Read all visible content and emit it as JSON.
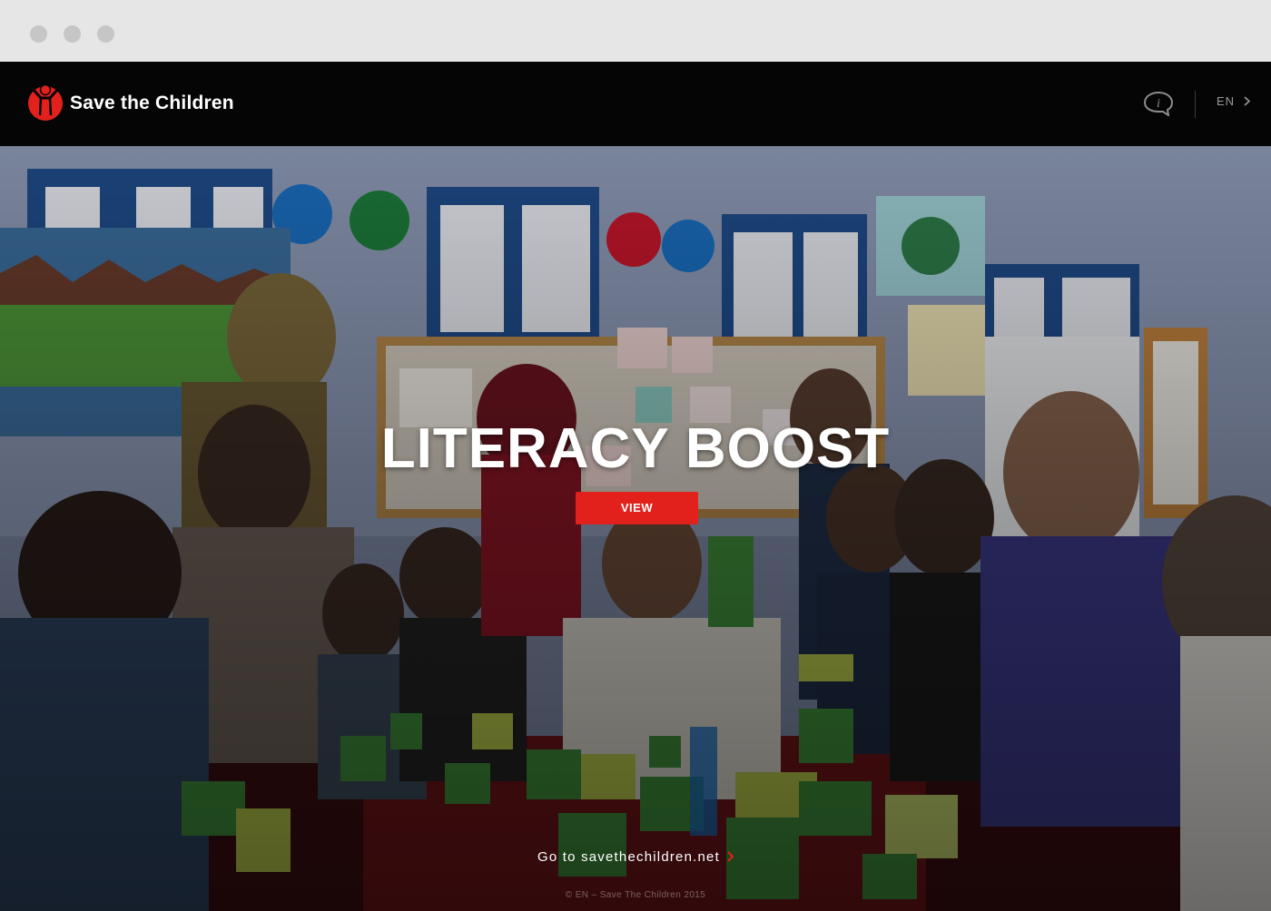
{
  "header": {
    "brand_name": "Save the Children",
    "language": "EN",
    "colors": {
      "brand_red": "#e2211c",
      "header_bg": "#050505"
    },
    "icons": [
      "save-the-children-logo",
      "info-icon",
      "chevron-right-icon"
    ]
  },
  "hero": {
    "title": "LITERACY BOOST",
    "view_label": "VIEW",
    "goto_label": "Go to savethechildren.net",
    "copyright": "© EN – Save The Children 2015"
  }
}
